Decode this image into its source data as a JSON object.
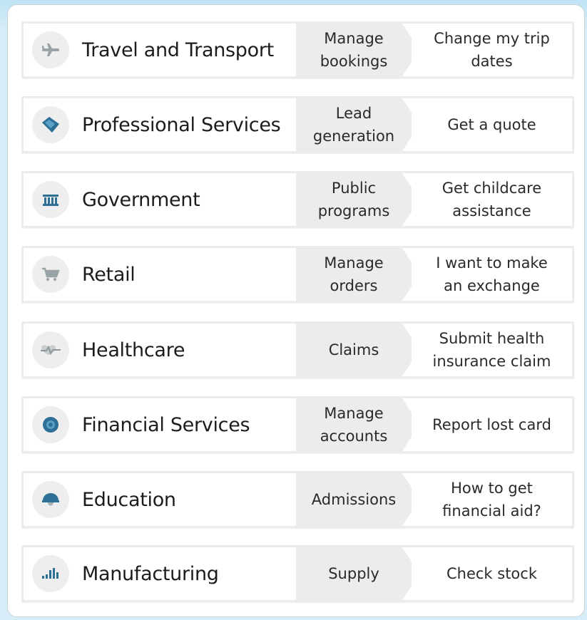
{
  "accent_color": "#2d7fa8",
  "rows": [
    {
      "industry": "Travel and Transport",
      "scenario": "Manage\nbookings",
      "example": "Change my trip\ndates",
      "icon": "airplane-icon"
    },
    {
      "industry": "Professional Services",
      "scenario": "Lead\ngeneration",
      "example": "Get a quote",
      "icon": "handshake-icon"
    },
    {
      "industry": "Government",
      "scenario": "Public\nprograms",
      "example": "Get childcare\nassistance",
      "icon": "government-building-icon"
    },
    {
      "industry": "Retail",
      "scenario": "Manage\norders",
      "example": "I want to make\nan exchange",
      "icon": "shopping-cart-icon"
    },
    {
      "industry": "Healthcare",
      "scenario": "Claims",
      "example": "Submit health\ninsurance claim",
      "icon": "heartbeat-icon"
    },
    {
      "industry": "Financial Services",
      "scenario": "Manage\naccounts",
      "example": "Report lost card",
      "icon": "coin-icon"
    },
    {
      "industry": "Education",
      "scenario": "Admissions",
      "example": "How to get\nfinancial aid?",
      "icon": "graduation-cap-icon"
    },
    {
      "industry": "Manufacturing",
      "scenario": "Supply",
      "example": "Check stock",
      "icon": "factory-chart-icon"
    }
  ]
}
